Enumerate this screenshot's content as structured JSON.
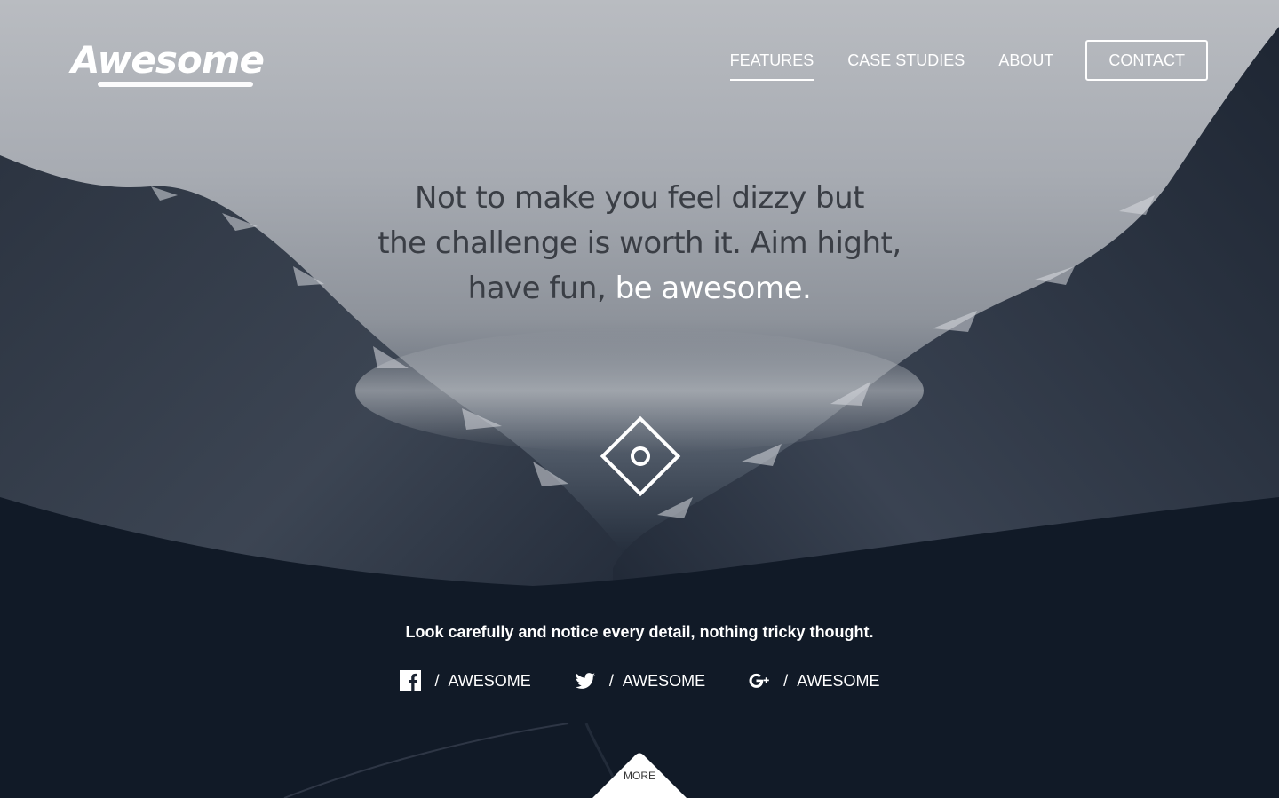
{
  "header": {
    "logo_text": "Awesome",
    "nav": [
      {
        "label": "FEATURES"
      },
      {
        "label": "CASE STUDIES"
      },
      {
        "label": "ABOUT"
      }
    ],
    "contact_label": "CONTACT"
  },
  "hero": {
    "headline_line1": "Not to make you feel dizzy but",
    "headline_line2": "the challenge is worth it. Aim hight,",
    "headline_line3_prefix": "have fun, ",
    "headline_line3_emphasis": "be awesome.",
    "tagline": "Look carefully and notice every detail, nothing tricky thought."
  },
  "social": [
    {
      "icon": "facebook-icon",
      "separator": "/",
      "label": "AWESOME"
    },
    {
      "icon": "twitter-icon",
      "separator": "/",
      "label": "AWESOME"
    },
    {
      "icon": "google-plus-icon",
      "separator": "/",
      "label": "AWESOME"
    }
  ],
  "more_label": "MORE",
  "colors": {
    "text_dark": "#3a3e45",
    "white": "#ffffff"
  }
}
